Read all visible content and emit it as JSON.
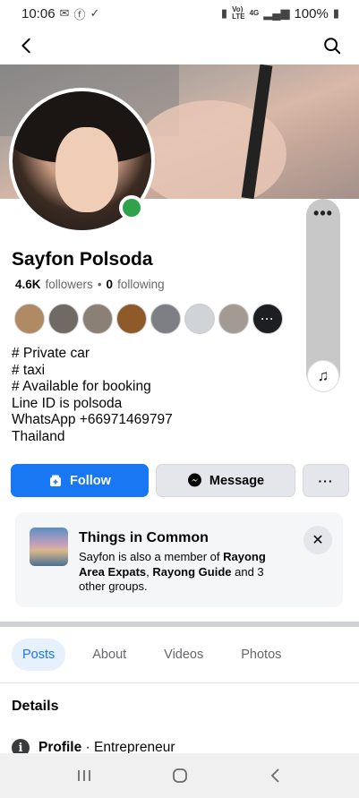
{
  "status_bar": {
    "time": "10:06",
    "left_icons": [
      "gmail-icon",
      "facebook-icon",
      "check-icon"
    ],
    "network_label": "Vo))\nLTE",
    "signal_label": "4G",
    "battery": "100%"
  },
  "nav": {
    "back_icon": "back-arrow-icon",
    "search_icon": "search-icon"
  },
  "profile": {
    "name": "Sayfon Polsoda",
    "followers_count": "4.6K",
    "followers_label": "followers",
    "separator": "•",
    "following_count": "0",
    "following_label": "following",
    "online": true,
    "bio_lines": [
      "# Private car",
      "# taxi",
      "# Available for booking",
      "Line ID is polsoda",
      "WhatsApp +66971469797",
      "Thailand"
    ]
  },
  "friends_preview": {
    "avatars": [
      "#b08a64",
      "#6f6a63",
      "#8a8076",
      "#8e5a2a",
      "#7d7f84",
      "#d0d3d8",
      "#a39a93"
    ],
    "more_label": "···"
  },
  "actions": {
    "follow_label": "Follow",
    "message_label": "Message",
    "more_label": "···"
  },
  "things_in_common": {
    "title": "Things in Common",
    "desc_prefix": "Sayfon is also a member of ",
    "group1": "Rayong Area Expats",
    "desc_mid": ", ",
    "group2": "Rayong Guide",
    "desc_suffix": " and 3 other groups."
  },
  "tabs": [
    {
      "label": "Posts",
      "active": true
    },
    {
      "label": "About",
      "active": false
    },
    {
      "label": "Videos",
      "active": false
    },
    {
      "label": "Photos",
      "active": false
    }
  ],
  "details": {
    "title": "Details",
    "profile_label": "Profile",
    "profile_value": " · Entrepreneur"
  },
  "colors": {
    "accent": "#1877f2",
    "online": "#31a24c"
  }
}
